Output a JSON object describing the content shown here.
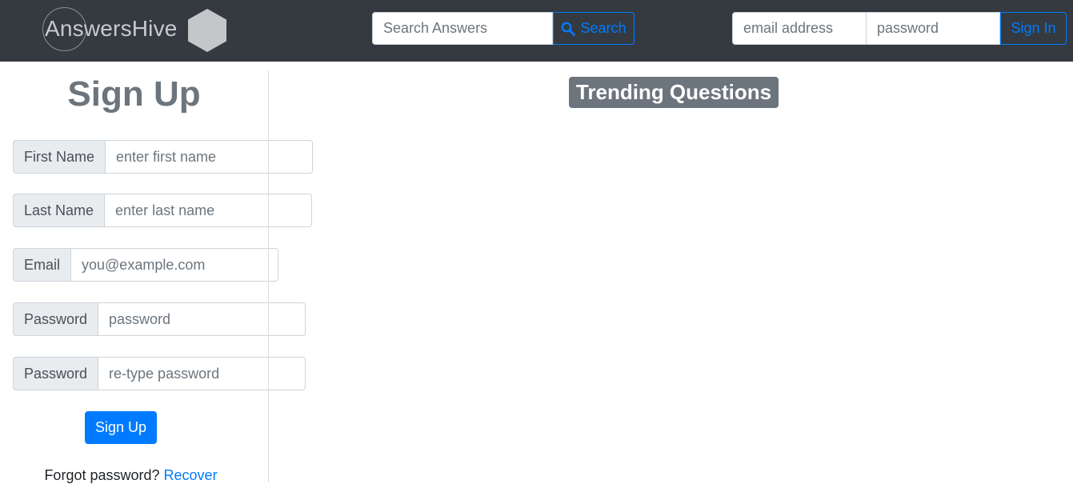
{
  "navbar": {
    "logo_text": "AnswersHive",
    "search": {
      "placeholder": "Search Answers",
      "button_label": "Search"
    },
    "login": {
      "email_placeholder": "email address",
      "password_placeholder": "password",
      "signin_label": "Sign In"
    }
  },
  "signup": {
    "title": "Sign Up",
    "fields": [
      {
        "label": "First Name",
        "placeholder": "enter first name"
      },
      {
        "label": "Last Name",
        "placeholder": "enter last name"
      },
      {
        "label": "Email",
        "placeholder": "you@example.com"
      },
      {
        "label": "Password",
        "placeholder": "password"
      },
      {
        "label": "Password",
        "placeholder": "re-type password"
      }
    ],
    "button_label": "Sign Up",
    "forgot_text": "Forgot password?",
    "recover_link": "Recover"
  },
  "main": {
    "trending_title": "Trending Questions"
  },
  "colors": {
    "navbar_bg": "#343a40",
    "primary": "#007bff",
    "secondary": "#6c757d"
  }
}
